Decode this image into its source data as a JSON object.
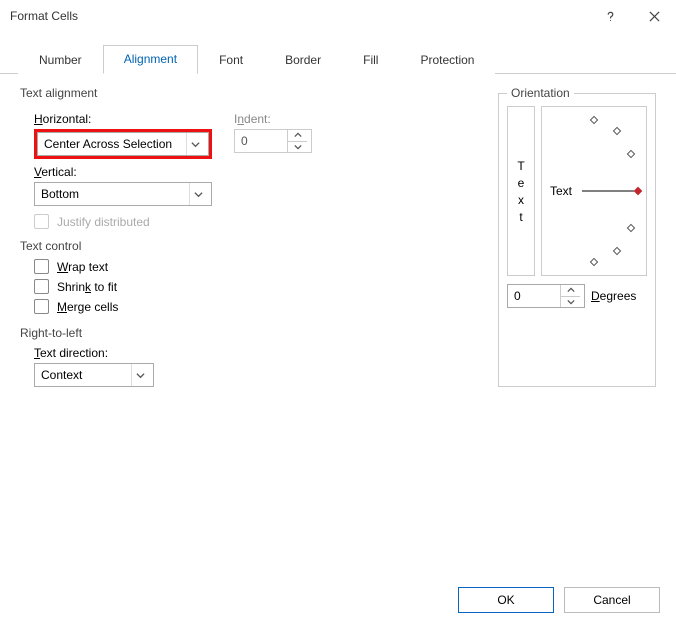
{
  "window": {
    "title": "Format Cells"
  },
  "tabs": [
    "Number",
    "Alignment",
    "Font",
    "Border",
    "Fill",
    "Protection"
  ],
  "text_alignment": {
    "section": "Text alignment",
    "horizontal_label": "Horizontal:",
    "horizontal_value": "Center Across Selection",
    "indent_label": "Indent:",
    "indent_value": "0",
    "vertical_label": "Vertical:",
    "vertical_value": "Bottom",
    "justify_distributed": "Justify distributed"
  },
  "text_control": {
    "section": "Text control",
    "wrap": "Wrap text",
    "shrink": "Shrink to fit",
    "merge": "Merge cells"
  },
  "rtl": {
    "section": "Right-to-left",
    "direction_label": "Text direction:",
    "direction_value": "Context"
  },
  "orientation": {
    "legend": "Orientation",
    "vertical_text": "Text",
    "dial_text": "Text",
    "degrees_value": "0",
    "degrees_label": "Degrees"
  },
  "buttons": {
    "ok": "OK",
    "cancel": "Cancel"
  }
}
